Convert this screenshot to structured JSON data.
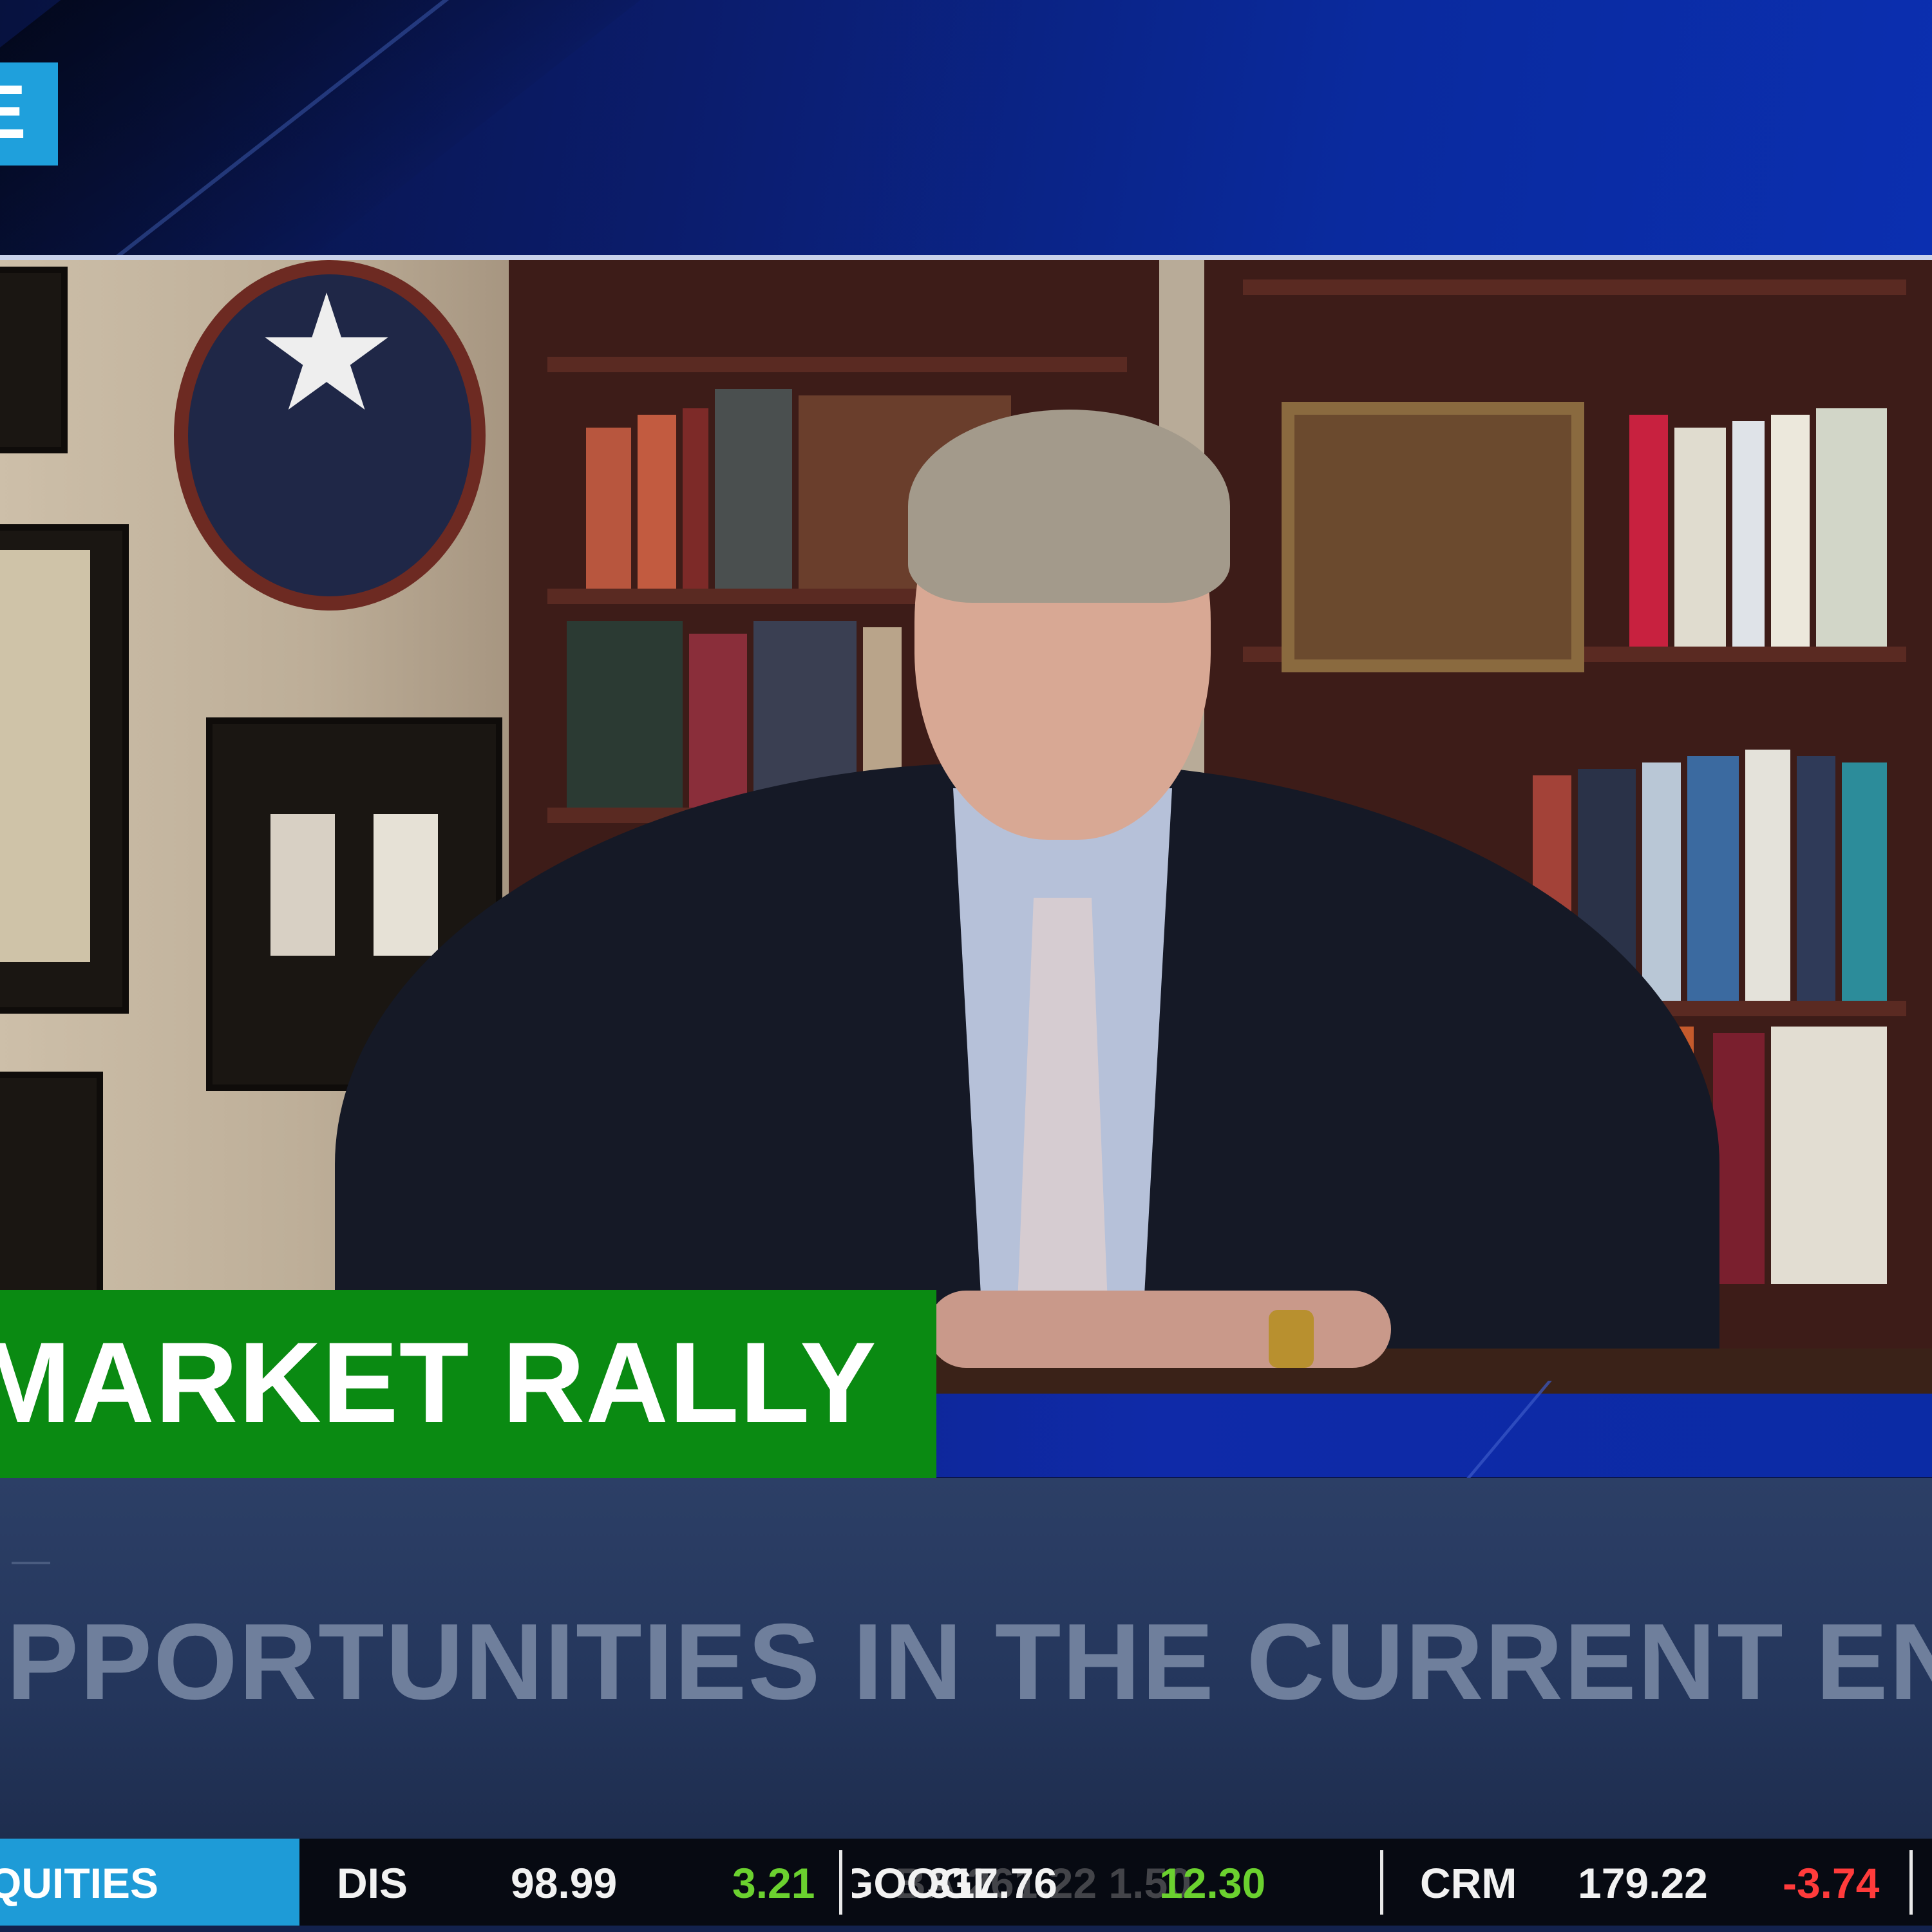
{
  "network_badge": {
    "letter": "E"
  },
  "headline": {
    "text": "MARKET RALLY",
    "bg_color": "#0a8a12"
  },
  "subtitle": {
    "text": "PPORTUNITIES IN THE CURRENT ENVIR"
  },
  "ticker": {
    "label": "QUITIES",
    "label_bg": "#1e9bd7",
    "items": [
      {
        "symbol": "DIS",
        "price": "98.99",
        "change": "3.21",
        "direction": "up"
      },
      {
        "symbol": "GOOGL",
        "price": "317.76",
        "change": "12.30",
        "direction": "up",
        "transition_overlay": "BA 261.22 1.50"
      },
      {
        "symbol": "CRM",
        "price": "179.22",
        "change": "-3.74",
        "direction": "down"
      }
    ],
    "up_color": "#6bd12f",
    "down_color": "#ff3b3b"
  },
  "colors": {
    "banner_blue": "#0b1c6b",
    "subtitle_bg": "#2c3f66"
  }
}
